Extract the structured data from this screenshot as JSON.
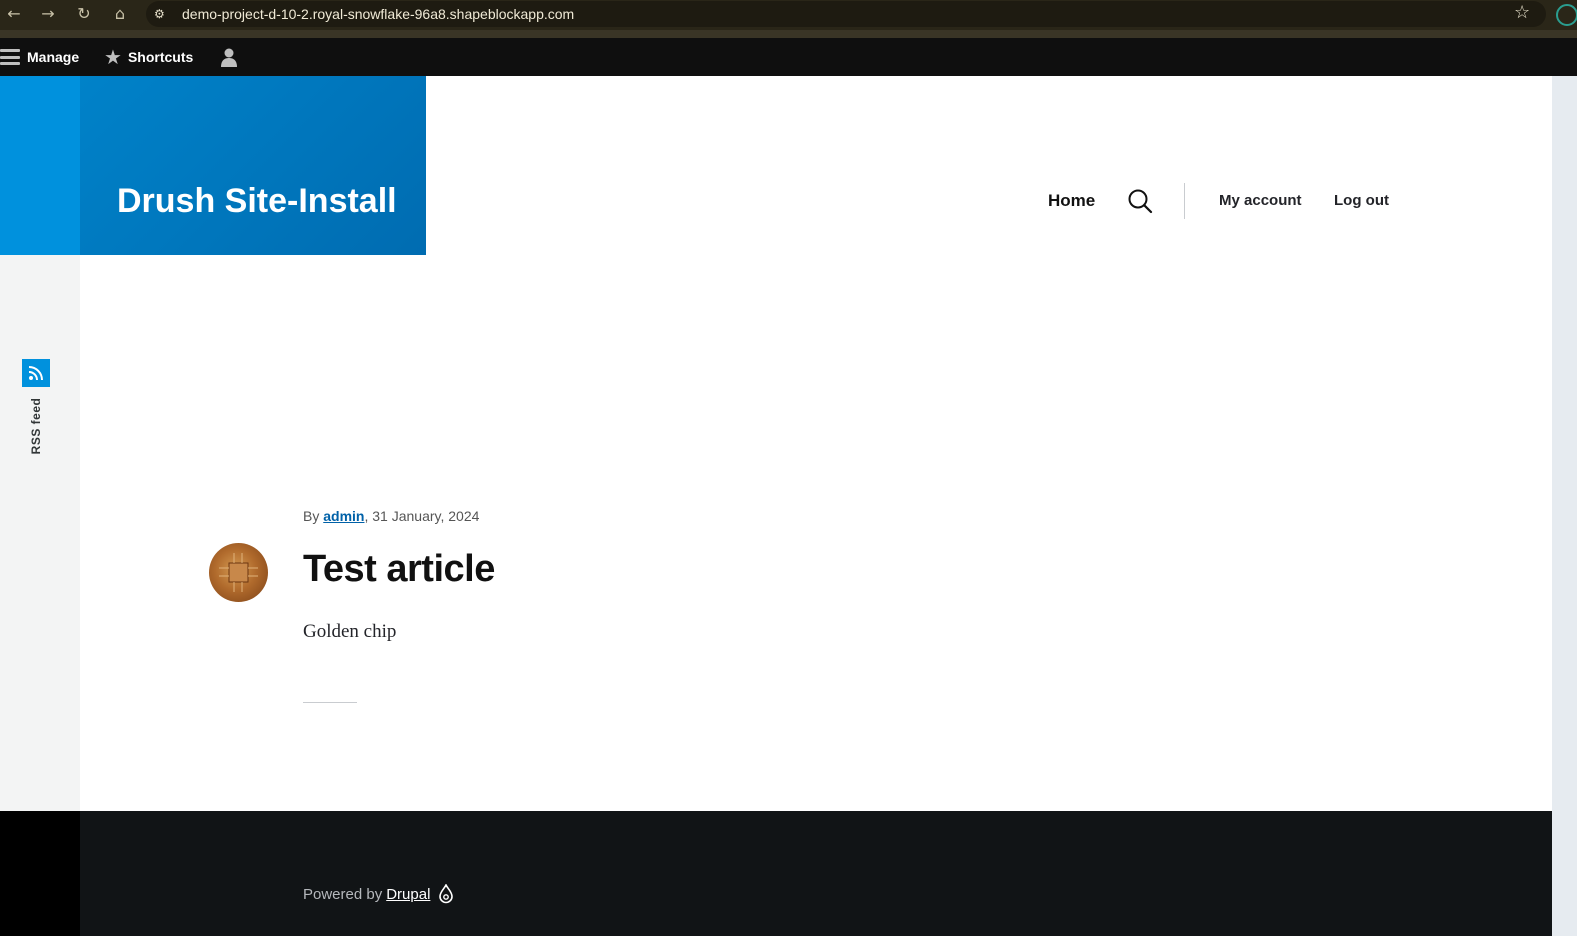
{
  "browser": {
    "url": "demo-project-d-10-2.royal-snowflake-96a8.shapeblockapp.com",
    "icons": [
      "back-icon",
      "forward-icon",
      "reload-icon",
      "home-icon",
      "site-settings-icon",
      "bookmark-star-icon"
    ]
  },
  "toolbar": {
    "manage_label": "Manage",
    "shortcuts_label": "Shortcuts"
  },
  "site": {
    "name": "Drush Site-Install"
  },
  "nav": {
    "home": "Home",
    "my_account": "My account",
    "log_out": "Log out"
  },
  "sidebar": {
    "rss_label": "RSS feed"
  },
  "article": {
    "by": "By",
    "author": "admin",
    "date": ", 31 January, 2024",
    "title": "Test article",
    "body": "Golden chip"
  },
  "footer": {
    "powered_by": "Powered by",
    "drupal": "Drupal"
  },
  "colors": {
    "brand_blue": "#0091dd",
    "branding_dark": "#006cb1",
    "footer_bg": "#111416",
    "toolbar_bg": "#0f0f0f"
  }
}
